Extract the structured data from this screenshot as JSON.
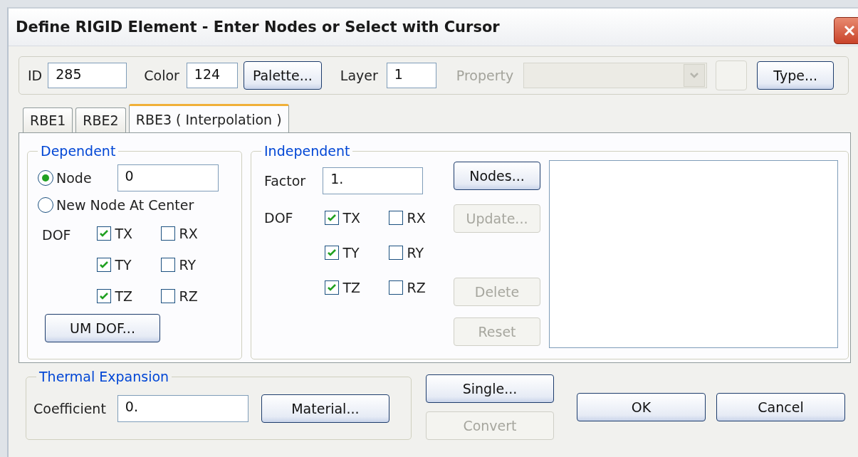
{
  "window": {
    "title": "Define RIGID Element - Enter Nodes or Select with Cursor"
  },
  "header": {
    "id": {
      "label": "ID",
      "value": "285"
    },
    "color": {
      "label": "Color",
      "value": "124"
    },
    "palette_button": "Palette...",
    "layer": {
      "label": "Layer",
      "value": "1"
    },
    "property": {
      "label": "Property",
      "disabled": true
    },
    "type_button": "Type..."
  },
  "tabs": [
    {
      "label": "RBE1",
      "selected": false
    },
    {
      "label": "RBE2",
      "selected": false
    },
    {
      "label": "RBE3 ( Interpolation )",
      "selected": true
    }
  ],
  "dependent": {
    "title": "Dependent",
    "options": [
      {
        "label": "Node",
        "selected": true,
        "value": "0"
      },
      {
        "label": "New Node At Center",
        "selected": false
      }
    ],
    "dof_label": "DOF",
    "dofs": [
      {
        "label": "TX",
        "checked": true
      },
      {
        "label": "RX",
        "checked": false
      },
      {
        "label": "TY",
        "checked": true
      },
      {
        "label": "RY",
        "checked": false
      },
      {
        "label": "TZ",
        "checked": true
      },
      {
        "label": "RZ",
        "checked": false
      }
    ],
    "um_button": "UM DOF..."
  },
  "independent": {
    "title": "Independent",
    "factor": {
      "label": "Factor",
      "value": "1."
    },
    "dof_label": "DOF",
    "dofs": [
      {
        "label": "TX",
        "checked": true
      },
      {
        "label": "RX",
        "checked": false
      },
      {
        "label": "TY",
        "checked": true
      },
      {
        "label": "RY",
        "checked": false
      },
      {
        "label": "TZ",
        "checked": true
      },
      {
        "label": "RZ",
        "checked": false
      }
    ],
    "buttons": [
      {
        "label": "Nodes...",
        "disabled": false
      },
      {
        "label": "Update...",
        "disabled": true
      },
      {
        "label": "Delete",
        "disabled": true
      },
      {
        "label": "Reset",
        "disabled": true
      }
    ]
  },
  "thermal": {
    "title": "Thermal Expansion",
    "coefficient": {
      "label": "Coefficient",
      "value": "0."
    },
    "material_button": "Material..."
  },
  "actions": [
    {
      "label": "Single...",
      "disabled": false
    },
    {
      "label": "Convert",
      "disabled": true
    },
    {
      "label": "OK",
      "disabled": false
    },
    {
      "label": "Cancel",
      "disabled": false
    }
  ]
}
